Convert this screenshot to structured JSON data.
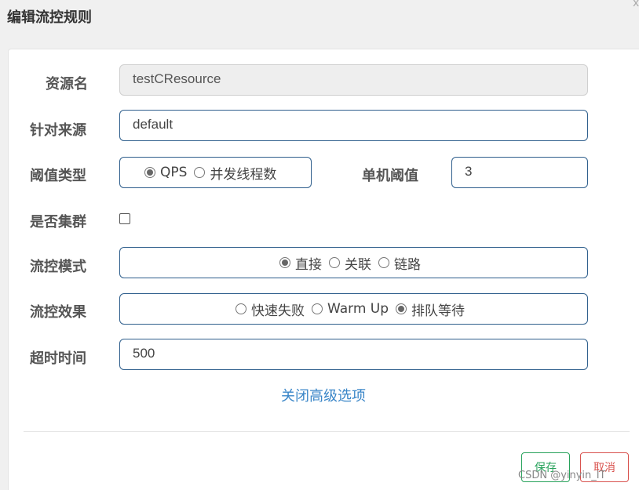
{
  "dialog": {
    "title": "编辑流控规则",
    "close": "x"
  },
  "form": {
    "resource": {
      "label": "资源名",
      "value": "testCResource"
    },
    "source": {
      "label": "针对来源",
      "value": "default"
    },
    "threshold_type": {
      "label": "阈值类型",
      "options": [
        "QPS",
        "并发线程数"
      ],
      "selected": "QPS"
    },
    "threshold": {
      "label": "单机阈值",
      "value": "3"
    },
    "cluster": {
      "label": "是否集群",
      "checked": false
    },
    "flow_mode": {
      "label": "流控模式",
      "options": [
        "直接",
        "关联",
        "链路"
      ],
      "selected": "直接"
    },
    "flow_effect": {
      "label": "流控效果",
      "options": [
        "快速失败",
        "Warm Up",
        "排队等待"
      ],
      "selected": "排队等待"
    },
    "timeout": {
      "label": "超时时间",
      "value": "500"
    },
    "advanced_link": "关闭高级选项"
  },
  "buttons": {
    "save": "保存",
    "cancel": "取消"
  },
  "watermark": "CSDN @yinyin_IT",
  "colors": {
    "input_border": "#2e5e8c",
    "link": "#3a86c8",
    "save": "#27a25b",
    "cancel": "#d9534f"
  }
}
